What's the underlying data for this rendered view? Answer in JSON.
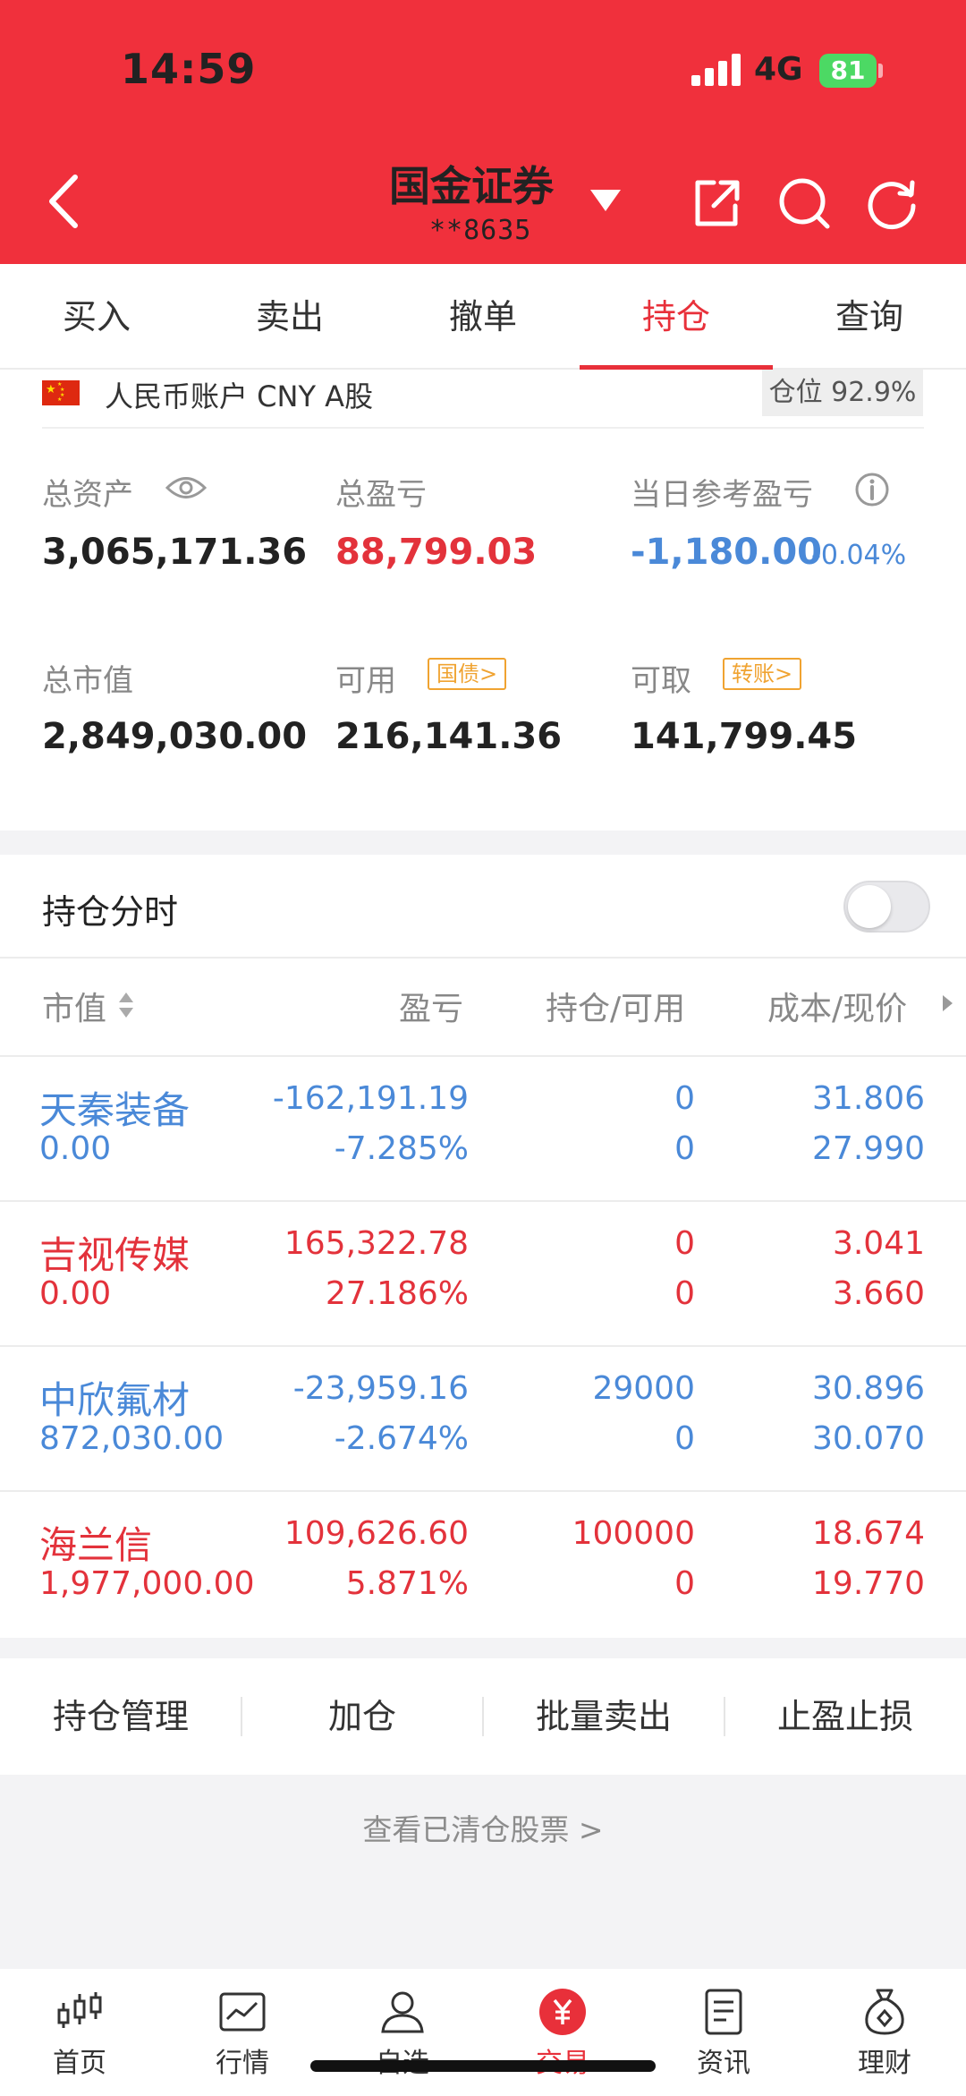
{
  "status_bar": {
    "time": "14:59",
    "network": "4G",
    "battery": "81"
  },
  "header": {
    "broker": "国金证券",
    "account": "**8635"
  },
  "tabs": [
    "买入",
    "卖出",
    "撤单",
    "持仓",
    "查询"
  ],
  "active_tab": "持仓",
  "account_bar": {
    "label": "人民币账户 CNY A股",
    "position_ratio": "仓位 92.9%"
  },
  "summary": {
    "total_assets": {
      "label": "总资产",
      "value": "3,065,171.36"
    },
    "total_pnl": {
      "label": "总盈亏",
      "value": "88,799.03"
    },
    "daily_pnl": {
      "label": "当日参考盈亏",
      "value": "-1,180.00",
      "pct": "-0.04%"
    },
    "market_value": {
      "label": "总市值",
      "value": "2,849,030.00"
    },
    "available": {
      "label": "可用",
      "tag": "国债>",
      "value": "216,141.36"
    },
    "withdrawable": {
      "label": "可取",
      "tag": "转账>",
      "value": "141,799.45"
    }
  },
  "position_timeshare": {
    "label": "持仓分时",
    "enabled": false
  },
  "columns": [
    "市值",
    "盈亏",
    "持仓/可用",
    "成本/现价"
  ],
  "holdings": [
    {
      "name": "天秦装备",
      "market_value": "0.00",
      "pnl": "-162,191.19",
      "pnl_pct": "-7.285%",
      "position": "0",
      "available": "0",
      "cost": "31.806",
      "price": "27.990",
      "color": "#4a89d8"
    },
    {
      "name": "吉视传媒",
      "market_value": "0.00",
      "pnl": "165,322.78",
      "pnl_pct": "27.186%",
      "position": "0",
      "available": "0",
      "cost": "3.041",
      "price": "3.660",
      "color": "#e3323b"
    },
    {
      "name": "中欣氟材",
      "market_value": "872,030.00",
      "pnl": "-23,959.16",
      "pnl_pct": "-2.674%",
      "position": "29000",
      "available": "0",
      "cost": "30.896",
      "price": "30.070",
      "color": "#4a89d8"
    },
    {
      "name": "海兰信",
      "market_value": "1,977,000.00",
      "pnl": "109,626.60",
      "pnl_pct": "5.871%",
      "position": "100000",
      "available": "0",
      "cost": "18.674",
      "price": "19.770",
      "color": "#e3323b"
    }
  ],
  "actions": [
    "持仓管理",
    "加仓",
    "批量卖出",
    "止盈止损"
  ],
  "cleared_link": "查看已清仓股票 >",
  "bottom_nav": [
    {
      "label": "首页",
      "icon": "candlestick-icon"
    },
    {
      "label": "行情",
      "icon": "chart-icon"
    },
    {
      "label": "自选",
      "icon": "person-icon"
    },
    {
      "label": "交易",
      "icon": "yuan-icon"
    },
    {
      "label": "资讯",
      "icon": "document-icon"
    },
    {
      "label": "理财",
      "icon": "moneybag-icon"
    }
  ],
  "bottom_nav_active": "交易",
  "colors": {
    "brand_red": "#f0303c",
    "gain": "#e3323b",
    "loss": "#4a89d8",
    "tag_orange": "#f0a331"
  }
}
